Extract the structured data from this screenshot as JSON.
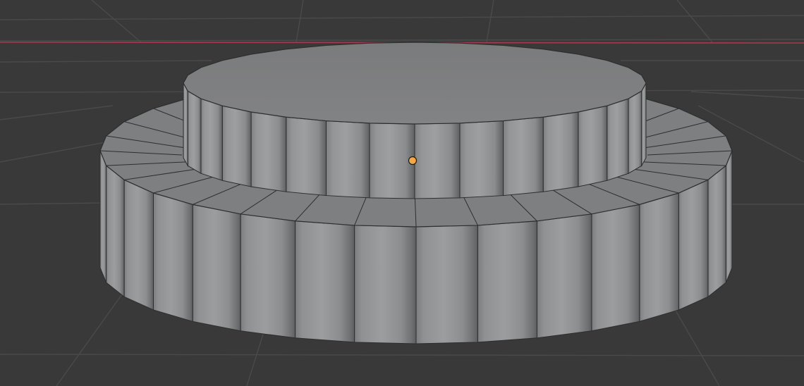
{
  "viewport": {
    "background_color": "#393939",
    "grid_line_color": "#4a4a4a",
    "x_axis_color": "#a8394c"
  },
  "object": {
    "type": "stacked cylinders (mesh)",
    "shading": "solid",
    "face_color": "#8e9091",
    "top_face_color": "#7d7e7f",
    "edge_color": "#2e2e2e",
    "origin_color": "#f5a742",
    "lower_cylinder_segments": 32,
    "upper_cylinder_segments": 32
  }
}
